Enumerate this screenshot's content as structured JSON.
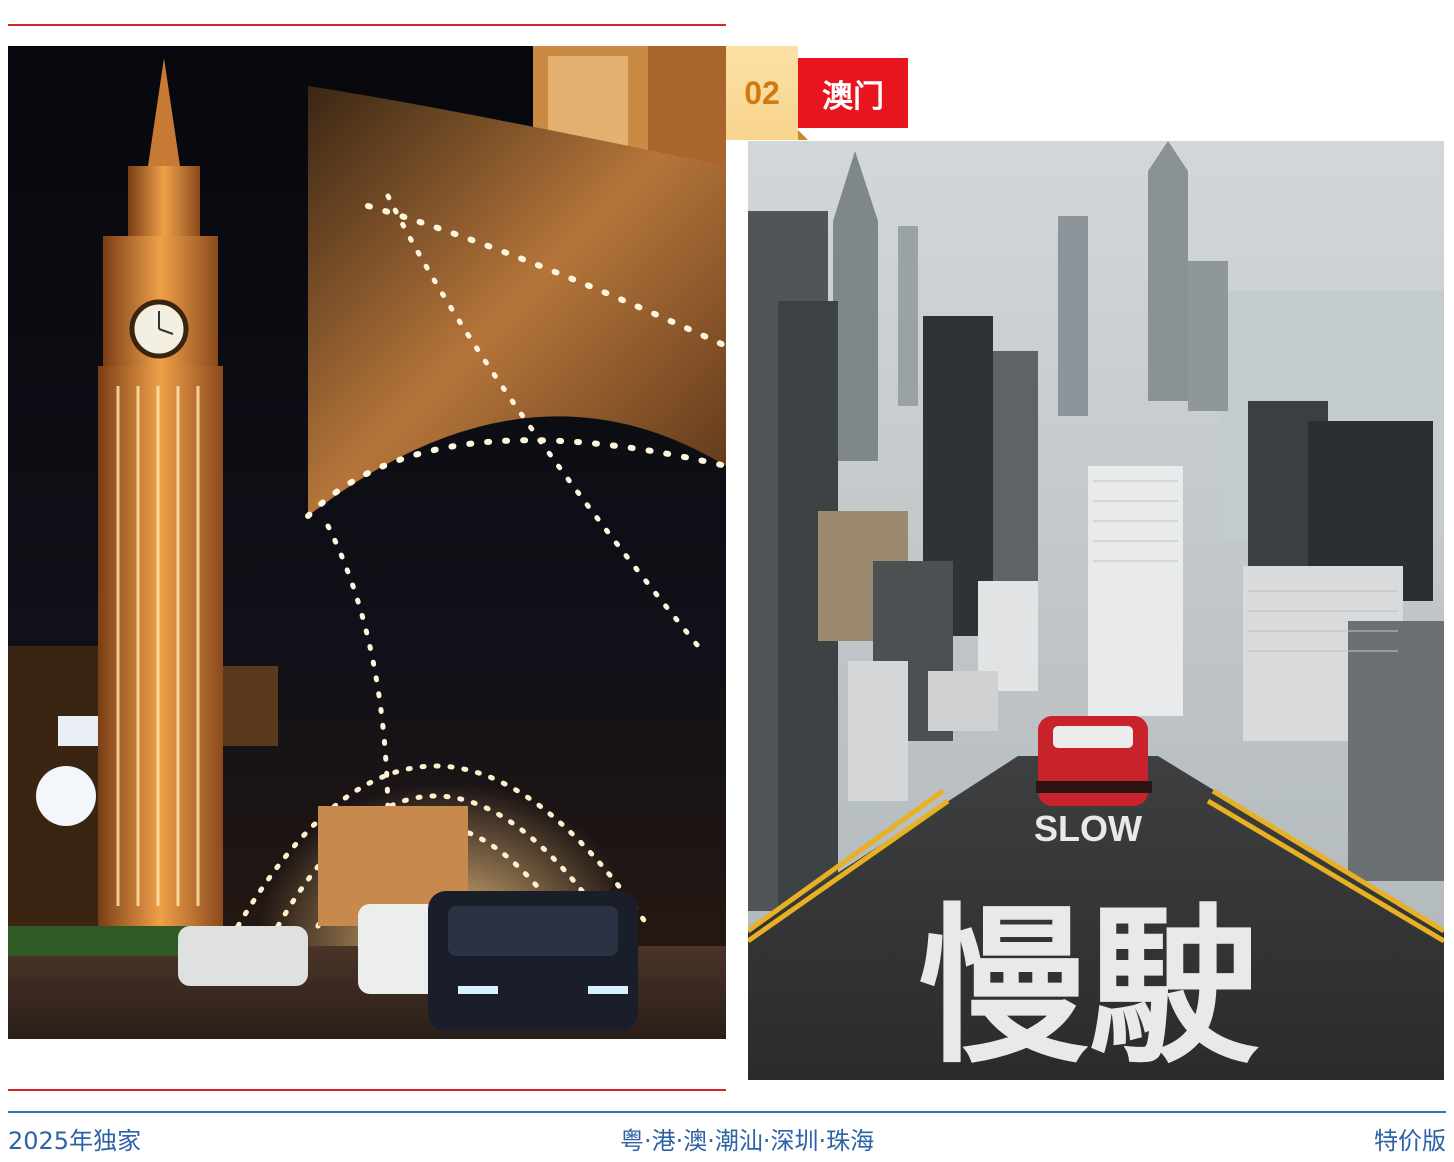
{
  "badge": {
    "number": "02",
    "title": "澳门"
  },
  "photos": {
    "left_alt": "澳门夜景：大笨钟与灯光长廊",
    "right_alt": "香港城市天际线与慢驶路面",
    "right_road_en": "SLOW",
    "right_road_zh": "慢駛"
  },
  "footer": {
    "left": "2025年独家",
    "center": "粤·港·澳·潮汕·深圳·珠海",
    "right": "特价版"
  },
  "colors": {
    "accent_red": "#e8151f",
    "rule_red": "#d9232a",
    "footer_blue": "#2d62a6",
    "badge_gold": "#f8d48d"
  }
}
